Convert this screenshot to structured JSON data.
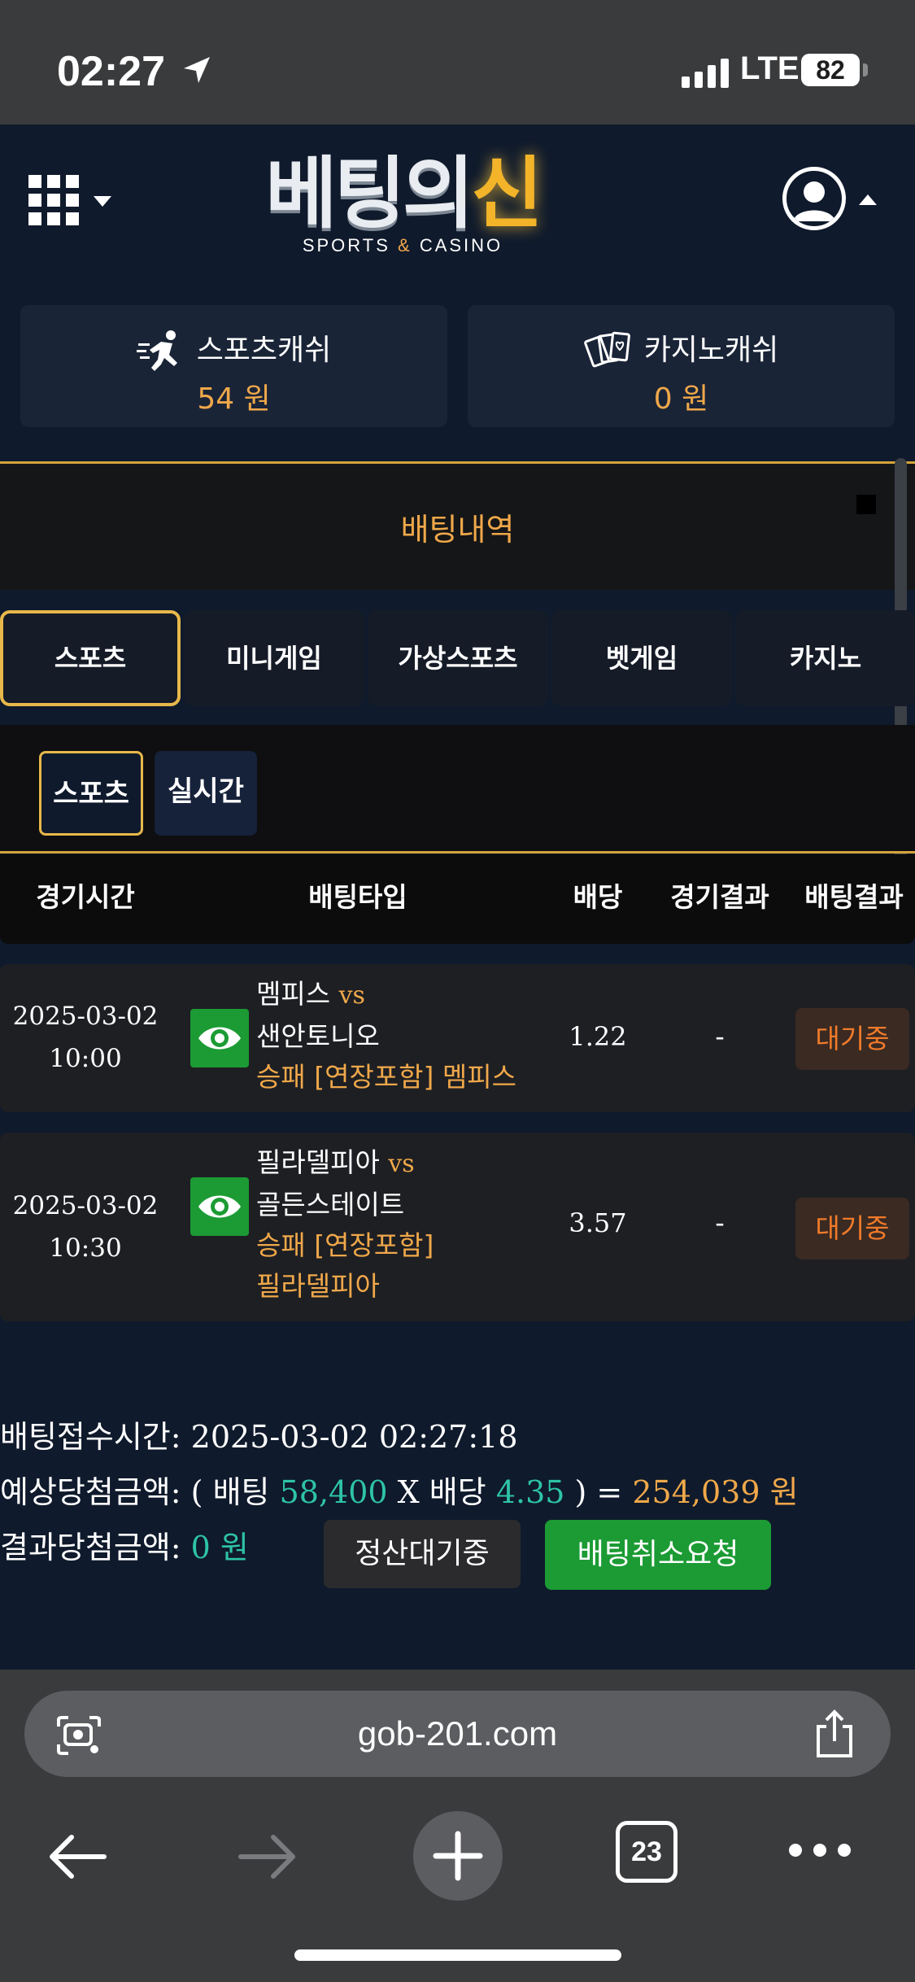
{
  "status_bar": {
    "time": "02:27",
    "network": "LTE",
    "battery": "82"
  },
  "header": {
    "logo_white": "베팅의",
    "logo_gold": "신",
    "logo_sub_left": "SPORTS",
    "logo_sub_amp": "&",
    "logo_sub_right": "CASINO"
  },
  "cash": {
    "sports_label": "스포츠캐쉬",
    "sports_value": "54 원",
    "casino_label": "카지노캐쉬",
    "casino_value": "0 원"
  },
  "history": {
    "title": "배팅내역"
  },
  "tabs": [
    "스포츠",
    "미니게임",
    "가상스포츠",
    "벳게임",
    "카지노"
  ],
  "subtabs": [
    "스포츠",
    "실시간"
  ],
  "table": {
    "headers": [
      "경기시간",
      "배팅타입",
      "배당",
      "경기결과",
      "배팅결과"
    ],
    "rows": [
      {
        "date": "2025-03-02",
        "time": "10:00",
        "home": "멤피스",
        "vs": "vs",
        "away": "샌안토니오",
        "pick1": "승패 [연장포함] 멤피스",
        "pick2": "",
        "odds": "1.22",
        "result": "-",
        "status": "대기중"
      },
      {
        "date": "2025-03-02",
        "time": "10:30",
        "home": "필라델피아",
        "vs": "vs",
        "away": "골든스테이트",
        "pick1": "승패 [연장포함]",
        "pick2": "필라델피아",
        "odds": "3.57",
        "result": "-",
        "status": "대기중"
      }
    ]
  },
  "summary": {
    "received_label": "배팅접수시간:",
    "received_value": "2025-03-02 02:27:18",
    "expected_label": "예상당첨금액:",
    "open_paren": "( 배팅",
    "bet_amount": "58,400",
    "x_label": "X 배당",
    "total_odds": "4.35",
    "close_eq": ") =",
    "expected_win": "254,039 원",
    "result_label": "결과당첨금액:",
    "result_value": "0 원",
    "pending_button": "정산대기중",
    "cancel_button": "배팅취소요청"
  },
  "browser": {
    "url": "gob-201.com",
    "tab_count": "23"
  },
  "colors": {
    "accent_gold": "#f0a84a",
    "accent_green": "#1c9b34",
    "accent_teal": "#2ec4a6",
    "status_orange": "#f07a2a"
  }
}
